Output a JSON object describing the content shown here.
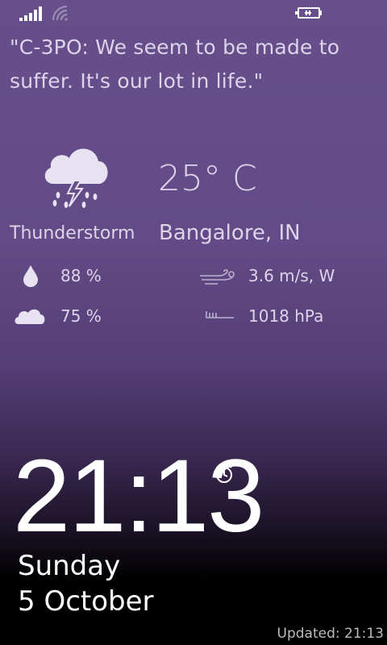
{
  "status_bar": {
    "signal_icon": "signal-bars-icon",
    "wifi_icon": "wifi-icon",
    "battery_icon": "battery-charging-icon"
  },
  "quote": "\"C-3PO:  We seem to be made to suffer. It's our lot in life.\"",
  "weather": {
    "icon": "thunderstorm-cloud-icon",
    "temperature": "25° C",
    "condition": "Thunderstorm",
    "location": "Bangalore, IN",
    "humidity": "88 %",
    "clouds": "75 %",
    "wind": "3.6 m/s, W",
    "pressure": "1018 hPa"
  },
  "clock": {
    "time": "21:13",
    "alarm_icon": "alarm-clock-icon",
    "day": "Sunday",
    "date": "5 October"
  },
  "updated": "Updated: 21:13"
}
